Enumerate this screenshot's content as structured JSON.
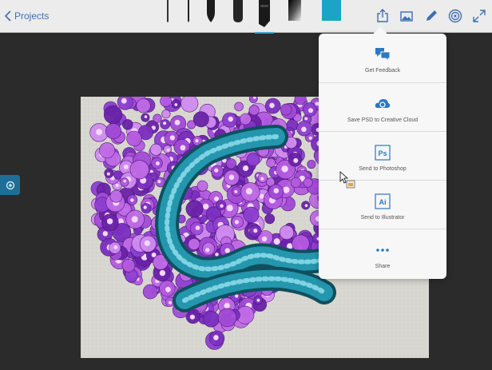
{
  "header": {
    "back_label": "Projects",
    "brushes": [
      "pencil-brush",
      "fine-pen-brush",
      "ink-brush",
      "round-marker-brush",
      "chisel-marker-brush",
      "airbrush-brush"
    ],
    "selected_brush": "chisel-marker-brush",
    "color_swatch": "#1ba4c4",
    "icons": [
      "share-icon",
      "image-icon",
      "pen-icon",
      "target-icon",
      "expand-icon"
    ]
  },
  "share_menu": {
    "items": [
      {
        "label": "Get Feedback",
        "icon": "feedback-icon"
      },
      {
        "label": "Save PSD to Creative Cloud",
        "icon": "creative-cloud-icon"
      },
      {
        "label": "Send to Photoshop",
        "icon": "photoshop-icon"
      },
      {
        "label": "Send to Illustrator",
        "icon": "illustrator-icon"
      },
      {
        "label": "Share",
        "icon": "more-icon"
      }
    ],
    "photoshop_glyph": "Ps",
    "illustrator_glyph": "Ai"
  },
  "colors": {
    "accent": "#1ba4c4",
    "link": "#3f6fb2",
    "flowers": "#a24bd6",
    "ribbon": "#1e7f94"
  }
}
